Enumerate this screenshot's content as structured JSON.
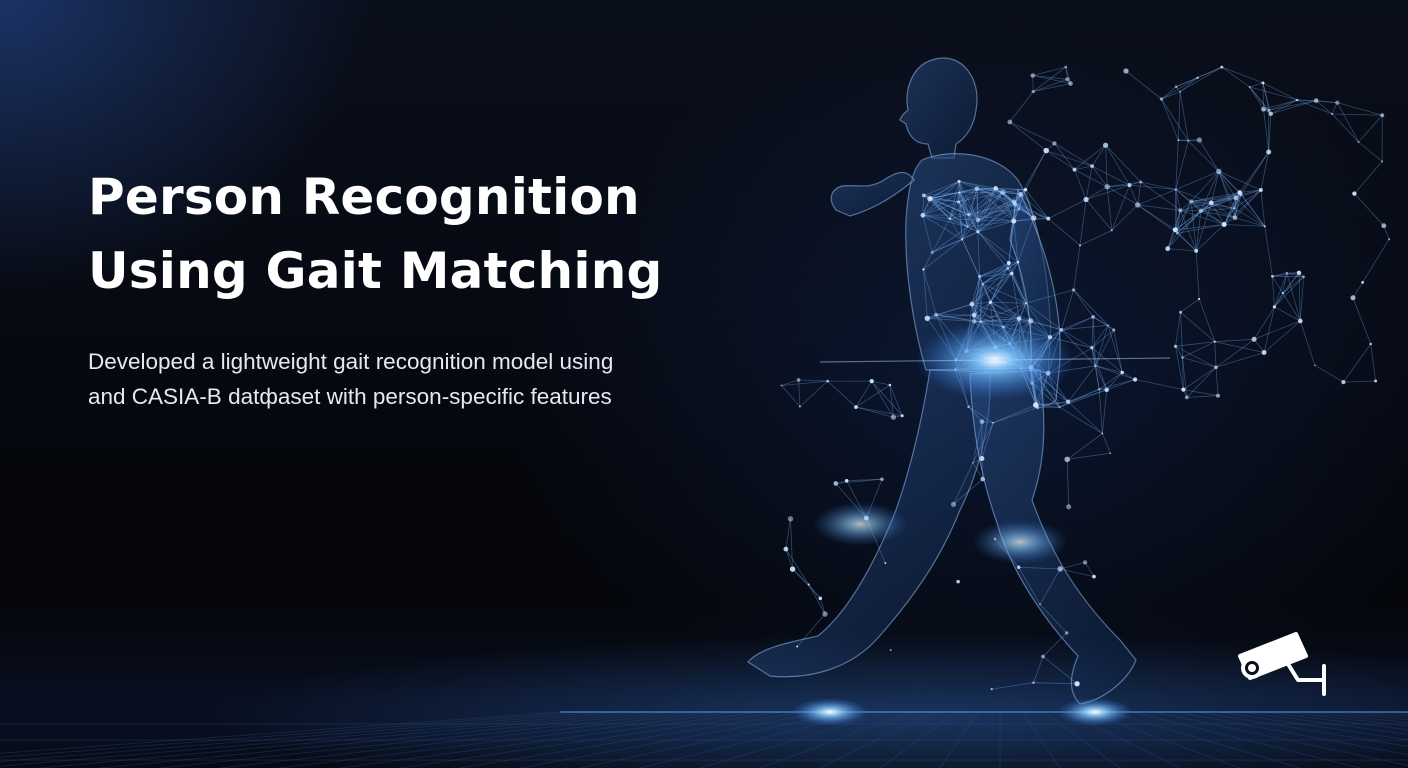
{
  "slide": {
    "title_line_1": "Person Recognition",
    "title_line_2": "Using Gait Matching",
    "subtitle_line_1": "Developed a lightweight gait recognition model using",
    "subtitle_line_2": "and CASIA-B datфaset with person-specific features"
  },
  "icons": {
    "camera": "security-camera-icon"
  },
  "colors": {
    "background": "#05070d",
    "glow_blue": "#4aa8ff",
    "text": "#ffffff"
  }
}
